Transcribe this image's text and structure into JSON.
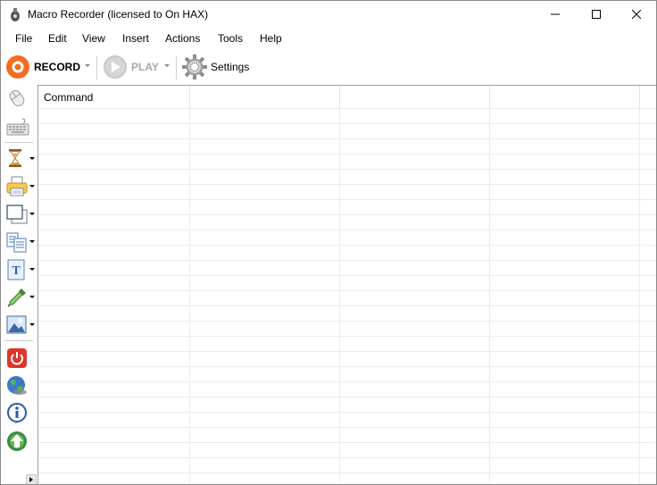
{
  "window": {
    "title": "Macro Recorder (licensed to On HAX)",
    "controls": [
      "minimize",
      "maximize",
      "close"
    ]
  },
  "menu": {
    "items": [
      "File",
      "Edit",
      "View",
      "Insert",
      "Actions",
      "Tools",
      "Help"
    ]
  },
  "toolbar": {
    "record_label": "RECORD",
    "play_label": "PLAY",
    "settings_label": "Settings",
    "colors": {
      "record": "#f26d21",
      "play_disabled": "#c8c8c8"
    }
  },
  "sidebar": {
    "tools": [
      {
        "icon": "mouse-icon"
      },
      {
        "icon": "keyboard-icon"
      },
      {
        "icon": "hourglass-icon"
      },
      {
        "icon": "printer-icon"
      },
      {
        "icon": "window-icon"
      },
      {
        "icon": "clipboard-icon"
      },
      {
        "icon": "text-icon"
      },
      {
        "icon": "eyedropper-icon"
      },
      {
        "icon": "image-icon"
      },
      {
        "icon": "power-icon"
      },
      {
        "icon": "globe-icon"
      },
      {
        "icon": "info-icon"
      },
      {
        "icon": "upload-icon"
      }
    ]
  },
  "grid": {
    "columns": [
      "Command",
      "",
      "",
      ""
    ],
    "rows": []
  }
}
